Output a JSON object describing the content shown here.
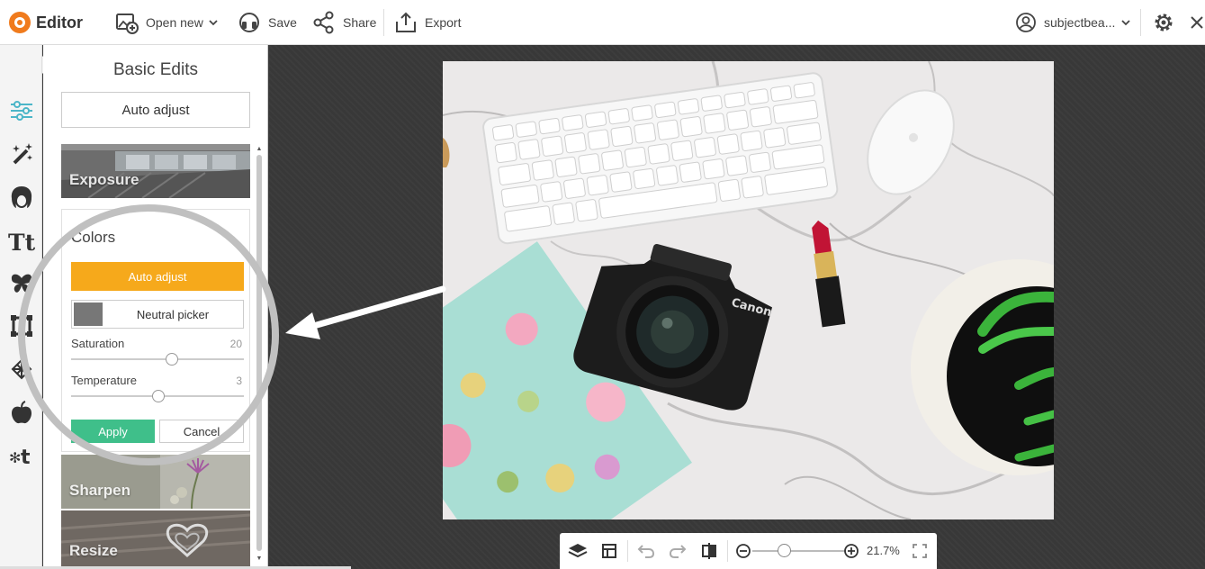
{
  "app": {
    "title": "Editor"
  },
  "toolbar": {
    "open_new": "Open new",
    "save": "Save",
    "share": "Share",
    "export": "Export",
    "account": "subjectbea..."
  },
  "sidebar": {
    "items": [
      {
        "name": "basic-edits",
        "icon": "sliders-icon"
      },
      {
        "name": "effects",
        "icon": "magic-wand-icon"
      },
      {
        "name": "touch-up",
        "icon": "face-icon"
      },
      {
        "name": "text",
        "icon": "text-icon"
      },
      {
        "name": "graphics",
        "icon": "butterfly-icon"
      },
      {
        "name": "frames",
        "icon": "frame-icon"
      },
      {
        "name": "textures",
        "icon": "texture-icon"
      },
      {
        "name": "seasonal",
        "icon": "apple-icon"
      },
      {
        "name": "themes",
        "icon": "themes-icon"
      }
    ]
  },
  "panel": {
    "title": "Basic Edits",
    "auto_adjust": "Auto adjust",
    "tiles": {
      "exposure": "Exposure",
      "sharpen": "Sharpen",
      "resize": "Resize"
    },
    "colors": {
      "title": "Colors",
      "auto_adjust": "Auto adjust",
      "neutral_picker": "Neutral picker",
      "saturation_label": "Saturation",
      "saturation_value": "20",
      "temperature_label": "Temperature",
      "temperature_value": "3",
      "apply": "Apply",
      "cancel": "Cancel"
    }
  },
  "bottom_bar": {
    "zoom": "21.7%"
  },
  "colors": {
    "accent_orange": "#f6a91b",
    "apply_green": "#3fbf8a",
    "canvas_bg": "#383838",
    "highlight_ring": "#c0c0c0"
  }
}
